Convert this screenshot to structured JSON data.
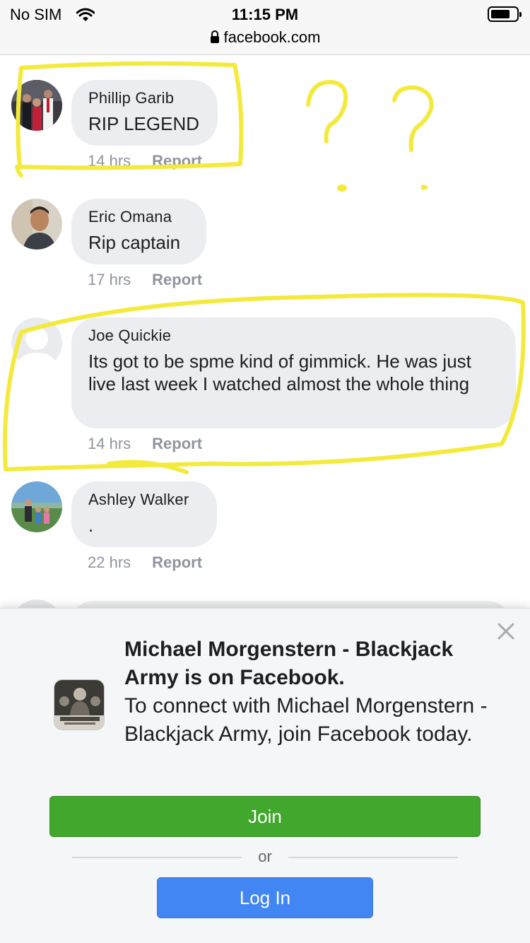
{
  "status_bar": {
    "carrier": "No SIM",
    "time": "11:15 PM",
    "url": "facebook.com"
  },
  "comments": [
    {
      "name": "Phillip Garib",
      "text": "RIP LEGEND",
      "time": "14 hrs",
      "report": "Report"
    },
    {
      "name": "Eric Omana",
      "text": "Rip captain",
      "time": "17 hrs",
      "report": "Report"
    },
    {
      "name": "Joe Quickie",
      "text": "Its got to be spme kind of gimmick. He was just live last week I watched almost the whole thing",
      "time": "14 hrs",
      "report": "Report"
    },
    {
      "name": "Ashley Walker",
      "text": ".",
      "time": "22 hrs",
      "report": "Report"
    }
  ],
  "login_prompt": {
    "title": "Michael Morgenstern - Blackjack Army is on Facebook.",
    "message": "To connect with Michael Morgenstern - Blackjack Army, join Facebook today.",
    "join_label": "Join",
    "or_label": "or",
    "login_label": "Log In"
  },
  "annotations": {
    "color": "#f3ea3c",
    "marks": "? ?"
  },
  "colors": {
    "join_green": "#42a72d",
    "login_blue": "#4286f4",
    "bubble_gray": "#ebedf0"
  }
}
